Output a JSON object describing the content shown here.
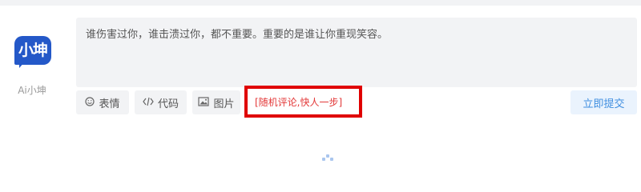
{
  "user": {
    "avatar_text": "小坤",
    "name": "Ai小坤"
  },
  "comment": {
    "content": "谁伤害过你，谁击溃过你，都不重要。重要的是谁让你重现笑容。"
  },
  "toolbar": {
    "emoji": {
      "icon": "smile-icon",
      "label": "表情"
    },
    "code": {
      "icon": "code-icon",
      "label": "代码"
    },
    "image": {
      "icon": "image-icon",
      "label": "图片"
    },
    "random_comment": "[随机评论,快人一步]",
    "submit": "立即提交"
  },
  "colors": {
    "accent": "#3f8ee0",
    "logo": "#2458c8",
    "highlight_border": "#e00000",
    "random_text": "#e33838"
  }
}
